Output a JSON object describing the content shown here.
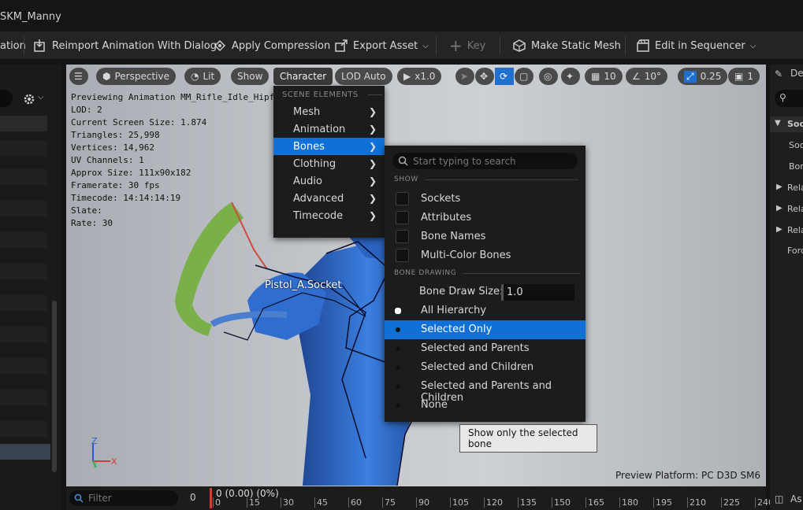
{
  "window": {
    "title": "SKM_Manny"
  },
  "toolbar": {
    "items": [
      {
        "label": "ation"
      },
      {
        "label": "Reimport Animation With Dialog"
      },
      {
        "label": "Apply Compression"
      },
      {
        "label": "Export Asset"
      },
      {
        "label": "Key"
      },
      {
        "label": "Make Static Mesh"
      },
      {
        "label": "Edit in Sequencer"
      }
    ]
  },
  "viewport": {
    "buttons": {
      "perspective": "Perspective",
      "lit": "Lit",
      "show": "Show",
      "character": "Character",
      "lod": "LOD Auto",
      "speed": "x1.0",
      "grid": "10",
      "rotation": "10°",
      "scale": "0.25",
      "camera": "1"
    },
    "stats": [
      "Previewing Animation MM_Rifle_Idle_Hipfire",
      "LOD: 2",
      "Current Screen Size: 1.874",
      "Triangles: 25,998",
      "Vertices: 14,962",
      "UV Channels: 1",
      "Approx Size: 111x90x182",
      "Framerate: 30 fps",
      "Timecode: 14:14:14:19",
      "Slate:",
      "Rate: 30"
    ],
    "socket_label": "Pistol_A.Socket",
    "axis": {
      "z": "Z",
      "x": "X",
      "y": "Y"
    },
    "platform": "Preview Platform:  PC D3D SM6"
  },
  "character_menu": {
    "header": "SCENE ELEMENTS",
    "items": [
      "Mesh",
      "Animation",
      "Bones",
      "Clothing",
      "Audio",
      "Advanced",
      "Timecode"
    ]
  },
  "bones_menu": {
    "search_placeholder": "Start typing to search",
    "show_header": "SHOW",
    "checkboxes": [
      "Sockets",
      "Attributes",
      "Bone Names",
      "Multi-Color Bones"
    ],
    "drawing_header": "BONE DRAWING",
    "draw_size_label": "Bone Draw Size:",
    "draw_size_value": "1.0",
    "radios": [
      "All Hierarchy",
      "Selected Only",
      "Selected and Parents",
      "Selected and Children",
      "Selected and Parents and Children",
      "None"
    ],
    "selected_radio": "All Hierarchy",
    "highlighted": "Selected Only"
  },
  "tooltip": "Show only the selected bone",
  "timeline": {
    "filter_placeholder": "Filter",
    "count": "0",
    "current": "0 (0.00) (0%)",
    "ticks": [
      "0",
      "15",
      "30",
      "45",
      "60",
      "75",
      "90",
      "105",
      "120",
      "135",
      "150",
      "165",
      "180",
      "195",
      "210",
      "225",
      "240"
    ]
  },
  "right_panel": {
    "details_label": "De",
    "rows": [
      "Soc",
      "Soc",
      "Bon",
      "Rela",
      "Rela",
      "Rela",
      "Ford"
    ],
    "asset_label": "As"
  }
}
